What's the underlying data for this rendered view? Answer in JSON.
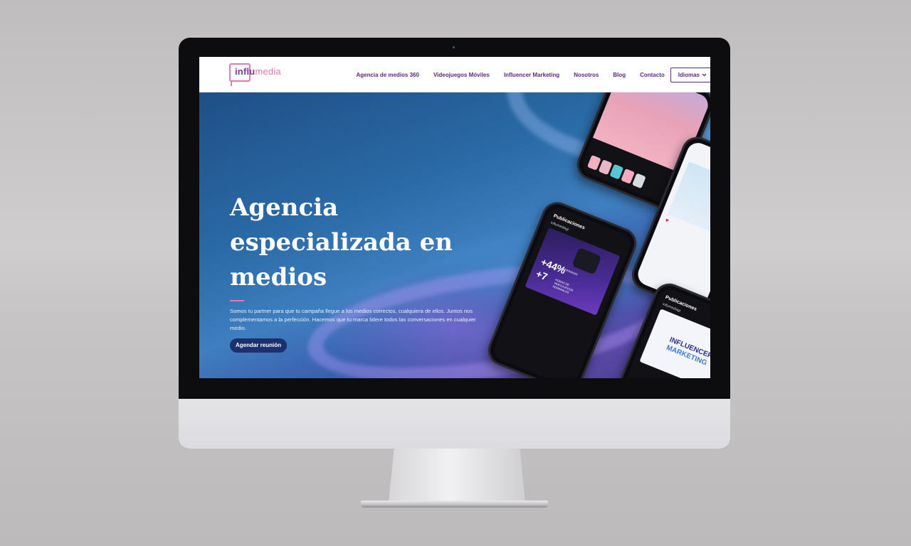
{
  "site": {
    "logo": {
      "part1": "influ",
      "part2": "media"
    },
    "nav": {
      "items": [
        {
          "label": "Agencia de medios 360"
        },
        {
          "label": "Videojuegos Móviles"
        },
        {
          "label": "Influencer Marketing"
        },
        {
          "label": "Nosotros"
        },
        {
          "label": "Blog"
        },
        {
          "label": "Contacto"
        }
      ],
      "language_button": "Idiomas"
    },
    "hero": {
      "title": "Agencia especializada en medios",
      "description": "Somos tu partner para que tu campaña llegue a los medios correctos, cualquiera de ellos. Juntos nos complementamos a la perfección. Hacemos que tu marca lidere todos las conversaciones en cualquier medio.",
      "cta": "Agendar reunión"
    },
    "phones": {
      "center": {
        "header": "Publicaciones",
        "account": "influmediagr",
        "stat1": "+44%",
        "stat1_caption": "PERSONAS",
        "stat2": "+7",
        "stat2_caption": "HORAS DE VIDEOJUEGOS SEMANALES"
      },
      "bottom": {
        "header": "Publicaciones",
        "account": "influmediagr",
        "line1": "INFLUENCER",
        "line2": "MARKETING"
      }
    }
  },
  "colors": {
    "brand_purple": "#5b2b7d",
    "brand_pink": "#e07ab0",
    "cta_bg": "#1c2f6e"
  }
}
